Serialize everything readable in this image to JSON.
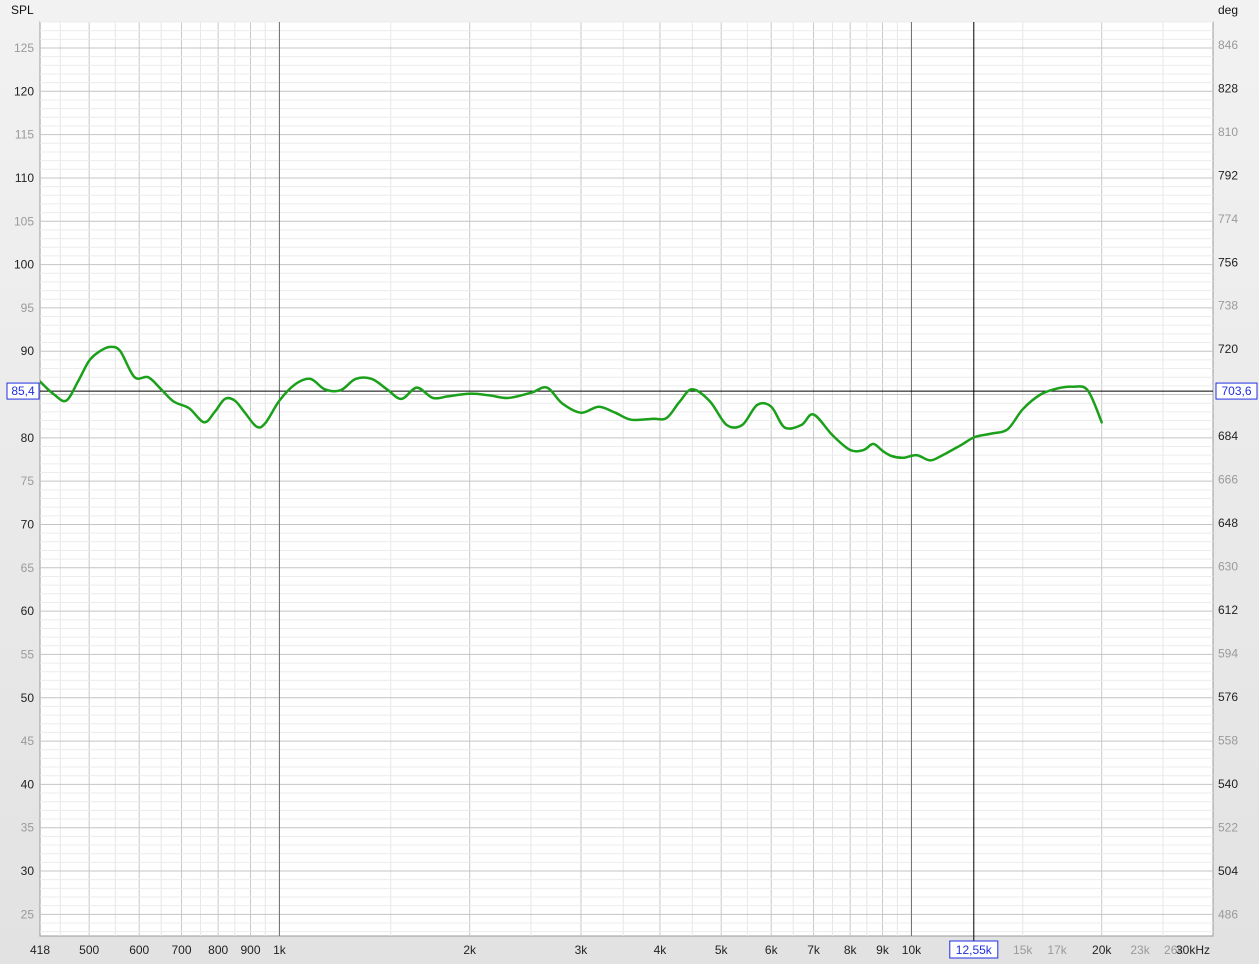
{
  "chart_data": {
    "type": "line",
    "title": "",
    "xlabel": "kHz",
    "ylabel_left": "SPL",
    "ylabel_right": "deg",
    "x_scale": "log",
    "xlim": [
      418,
      30000
    ],
    "ylim": [
      22.5,
      128
    ],
    "ylim_right": [
      477,
      855.5
    ],
    "grid": true,
    "x_major_ticks": [
      {
        "value": 418,
        "label": "418"
      },
      {
        "value": 500,
        "label": "500"
      },
      {
        "value": 600,
        "label": "600"
      },
      {
        "value": 700,
        "label": "700"
      },
      {
        "value": 800,
        "label": "800"
      },
      {
        "value": 900,
        "label": "900"
      },
      {
        "value": 1000,
        "label": "1k"
      },
      {
        "value": 2000,
        "label": "2k"
      },
      {
        "value": 3000,
        "label": "3k"
      },
      {
        "value": 4000,
        "label": "4k"
      },
      {
        "value": 5000,
        "label": "5k"
      },
      {
        "value": 6000,
        "label": "6k"
      },
      {
        "value": 7000,
        "label": "7k"
      },
      {
        "value": 8000,
        "label": "8k"
      },
      {
        "value": 9000,
        "label": "9k"
      },
      {
        "value": 10000,
        "label": "10k"
      },
      {
        "value": 20000,
        "label": "20k"
      }
    ],
    "x_minor_ticks": [
      {
        "value": 15000,
        "label": "15k"
      },
      {
        "value": 17000,
        "label": "17k"
      },
      {
        "value": 23000,
        "label": "23k"
      },
      {
        "value": 26000,
        "label": "26k"
      },
      {
        "value": 30000,
        "label": "30kHz"
      }
    ],
    "y_ticks_left": [
      {
        "value": 125,
        "label": "125",
        "major": false
      },
      {
        "value": 120,
        "label": "120",
        "major": true
      },
      {
        "value": 115,
        "label": "115",
        "major": false
      },
      {
        "value": 110,
        "label": "110",
        "major": true
      },
      {
        "value": 105,
        "label": "105",
        "major": false
      },
      {
        "value": 100,
        "label": "100",
        "major": true
      },
      {
        "value": 95,
        "label": "95",
        "major": false
      },
      {
        "value": 90,
        "label": "90",
        "major": true
      },
      {
        "value": 80,
        "label": "80",
        "major": true
      },
      {
        "value": 75,
        "label": "75",
        "major": false
      },
      {
        "value": 70,
        "label": "70",
        "major": true
      },
      {
        "value": 65,
        "label": "65",
        "major": false
      },
      {
        "value": 60,
        "label": "60",
        "major": true
      },
      {
        "value": 55,
        "label": "55",
        "major": false
      },
      {
        "value": 50,
        "label": "50",
        "major": true
      },
      {
        "value": 45,
        "label": "45",
        "major": false
      },
      {
        "value": 40,
        "label": "40",
        "major": true
      },
      {
        "value": 35,
        "label": "35",
        "major": false
      },
      {
        "value": 30,
        "label": "30",
        "major": true
      },
      {
        "value": 25,
        "label": "25",
        "major": false
      }
    ],
    "y_ticks_right": [
      {
        "value": 846,
        "label": "846",
        "major": false
      },
      {
        "value": 828,
        "label": "828",
        "major": true
      },
      {
        "value": 810,
        "label": "810",
        "major": false
      },
      {
        "value": 792,
        "label": "792",
        "major": true
      },
      {
        "value": 774,
        "label": "774",
        "major": false
      },
      {
        "value": 756,
        "label": "756",
        "major": true
      },
      {
        "value": 738,
        "label": "738",
        "major": false
      },
      {
        "value": 720,
        "label": "720",
        "major": true
      },
      {
        "value": 684,
        "label": "684",
        "major": true
      },
      {
        "value": 666,
        "label": "666",
        "major": false
      },
      {
        "value": 648,
        "label": "648",
        "major": true
      },
      {
        "value": 630,
        "label": "630",
        "major": false
      },
      {
        "value": 612,
        "label": "612",
        "major": true
      },
      {
        "value": 594,
        "label": "594",
        "major": false
      },
      {
        "value": 576,
        "label": "576",
        "major": true
      },
      {
        "value": 558,
        "label": "558",
        "major": false
      },
      {
        "value": 540,
        "label": "540",
        "major": true
      },
      {
        "value": 522,
        "label": "522",
        "major": false
      },
      {
        "value": 504,
        "label": "504",
        "major": true
      },
      {
        "value": 486,
        "label": "486",
        "major": false
      }
    ],
    "cursor": {
      "x": 12550,
      "y": 85.4,
      "x_label": "12,55k",
      "y_label": "85,4",
      "y_right_label": "703,6"
    },
    "series": [
      {
        "color": "#1aa01a",
        "x": [
          418,
          440,
          460,
          480,
          500,
          520,
          540,
          560,
          590,
          620,
          650,
          680,
          720,
          760,
          790,
          820,
          850,
          880,
          920,
          950,
          1000,
          1060,
          1120,
          1180,
          1250,
          1320,
          1400,
          1480,
          1560,
          1650,
          1750,
          1850,
          2000,
          2150,
          2300,
          2500,
          2650,
          2800,
          3000,
          3200,
          3400,
          3600,
          3900,
          4100,
          4300,
          4500,
          4800,
          5100,
          5400,
          5700,
          6000,
          6300,
          6700,
          7000,
          7500,
          8000,
          8400,
          8700,
          9000,
          9300,
          9700,
          10200,
          10700,
          11200,
          12000,
          12600,
          13400,
          14200,
          15000,
          16000,
          17000,
          18000,
          19000,
          20000
        ],
        "values": [
          86.5,
          85.0,
          84.3,
          86.5,
          88.9,
          90.0,
          90.5,
          90.0,
          87.0,
          87.0,
          85.6,
          84.2,
          83.4,
          81.8,
          83.0,
          84.5,
          84.3,
          83.0,
          81.3,
          81.7,
          84.3,
          86.2,
          86.8,
          85.6,
          85.5,
          86.8,
          86.8,
          85.6,
          84.5,
          85.8,
          84.6,
          84.8,
          85.1,
          84.9,
          84.6,
          85.2,
          85.8,
          84.0,
          82.9,
          83.6,
          82.9,
          82.1,
          82.2,
          82.3,
          84.2,
          85.6,
          84.2,
          81.5,
          81.5,
          83.8,
          83.6,
          81.2,
          81.5,
          82.7,
          80.3,
          78.6,
          78.6,
          79.3,
          78.5,
          77.9,
          77.7,
          78.0,
          77.4,
          78.0,
          79.2,
          80.1,
          80.5,
          81.0,
          83.3,
          85.0,
          85.7,
          85.9,
          85.5,
          81.8
        ]
      }
    ]
  }
}
